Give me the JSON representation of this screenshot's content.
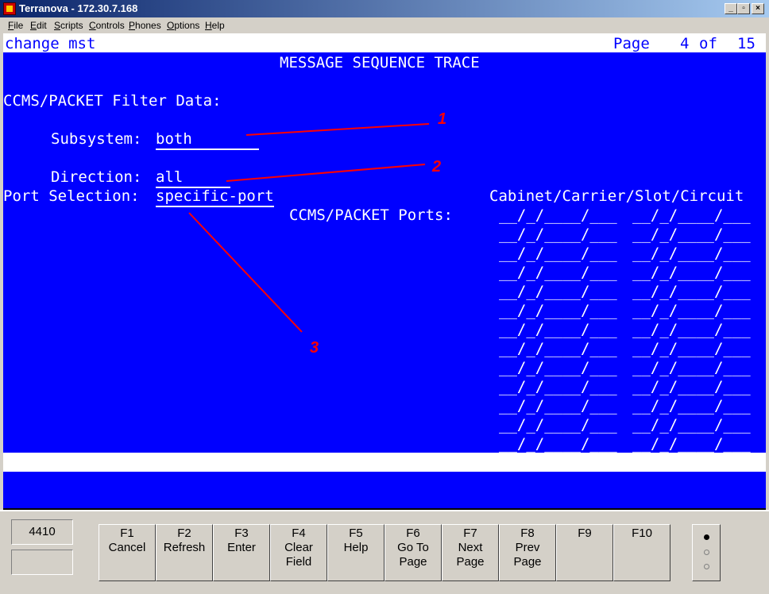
{
  "window": {
    "title": "Terranova - 172.30.7.168",
    "controls": {
      "minimize": "_",
      "maximize": "▫",
      "close": "×"
    }
  },
  "menu": [
    "File",
    "Edit",
    "Scripts",
    "Controls",
    "Phones",
    "Options",
    "Help"
  ],
  "terminal": {
    "command": "change mst",
    "page_label": "Page",
    "page_current": "4",
    "page_of": "of",
    "page_total": "15",
    "heading": "MESSAGE SEQUENCE TRACE",
    "filter_heading": "CCMS/PACKET Filter Data:",
    "subsystem_label": "Subsystem:",
    "subsystem_value": "both",
    "direction_label": "Direction:",
    "direction_value": "all",
    "port_selection_label": "Port Selection:",
    "port_selection_value": "specific-port",
    "ports_label": "CCMS/PACKET Ports:",
    "cabinet_header": "Cabinet/Carrier/Slot/Circuit",
    "port_field_mask": "__/_/____/___",
    "port_rows": 13
  },
  "annotations": [
    "1",
    "2",
    "3"
  ],
  "annotation_color": "#ff0000",
  "bottom": {
    "extension": "4410",
    "extension2": "",
    "function_keys": [
      {
        "key": "F1",
        "lines": [
          "Cancel"
        ]
      },
      {
        "key": "F2",
        "lines": [
          "Refresh"
        ]
      },
      {
        "key": "F3",
        "lines": [
          "Enter"
        ]
      },
      {
        "key": "F4",
        "lines": [
          "Clear",
          "Field"
        ]
      },
      {
        "key": "F5",
        "lines": [
          "Help"
        ]
      },
      {
        "key": "F6",
        "lines": [
          "Go To",
          "Page"
        ]
      },
      {
        "key": "F7",
        "lines": [
          "Next",
          "Page"
        ]
      },
      {
        "key": "F8",
        "lines": [
          "Prev",
          "Page"
        ]
      },
      {
        "key": "F9",
        "lines": []
      },
      {
        "key": "F10",
        "lines": []
      }
    ]
  }
}
